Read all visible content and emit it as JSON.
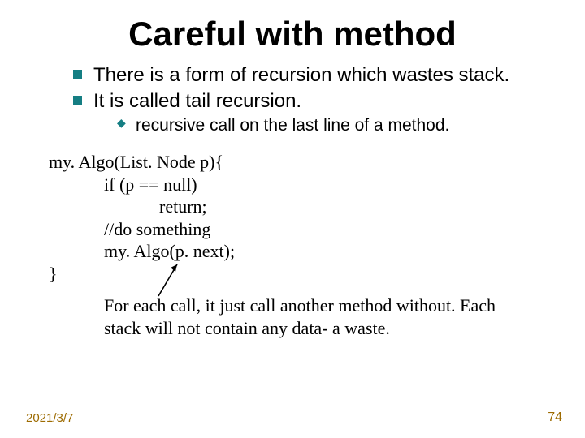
{
  "title": "Careful with method",
  "bullets": {
    "b1": "There is a form of recursion which wastes stack.",
    "b2": "It is called tail recursion.",
    "sub1": "recursive call on the last line of a method."
  },
  "code": {
    "l1": "my. Algo(List. Node p){",
    "l2": "if (p == null)",
    "l3": "return;",
    "l4": "//do something",
    "l5": "my. Algo(p. next);",
    "l6": "}"
  },
  "note": "For each call, it just call another method without. Each stack will not contain any data- a waste.",
  "footer": {
    "date": "2021/3/7",
    "page": "74"
  }
}
